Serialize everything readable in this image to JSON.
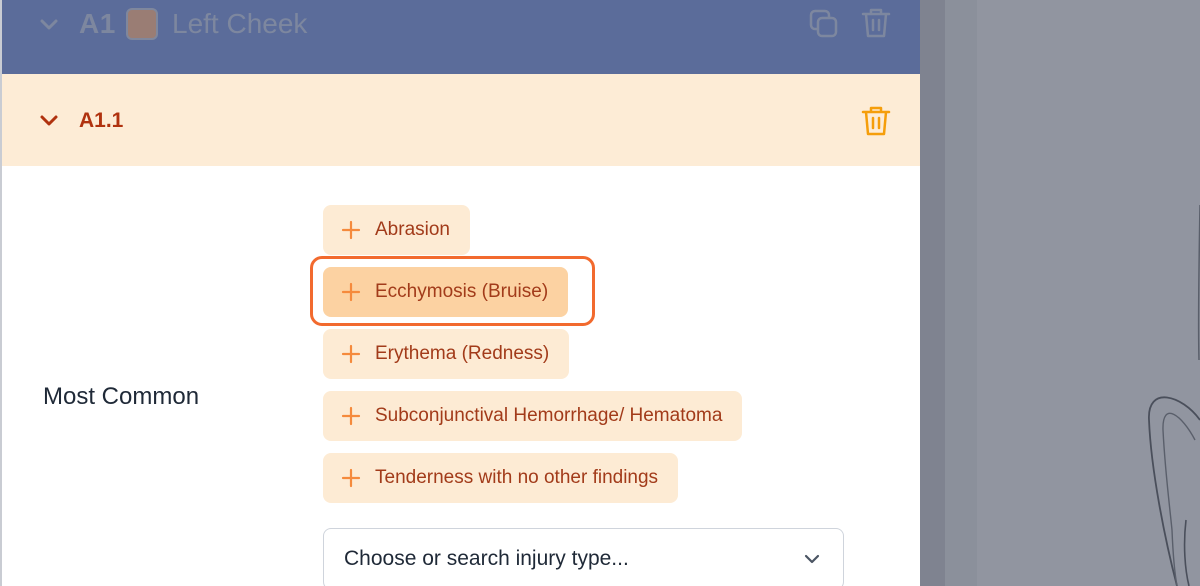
{
  "region": {
    "code": "A1",
    "name": "Left Cheek",
    "swatch_color": "#9a7d74",
    "header_color": "#5b6c9a"
  },
  "subregion": {
    "code": "A1.1",
    "header_color": "#fdecd6",
    "accent_color": "#b0320f",
    "trash_color": "#f59e0b"
  },
  "injuries": {
    "section_label": "Most Common",
    "chips": [
      {
        "label": "Abrasion",
        "selected": false
      },
      {
        "label": "Ecchymosis (Bruise)",
        "selected": true
      },
      {
        "label": "Erythema (Redness)",
        "selected": false
      },
      {
        "label": "Subconjunctival Hemorrhage/ Hematoma",
        "selected": false
      },
      {
        "label": "Tenderness with no other findings",
        "selected": false
      }
    ],
    "chip_color": "#fdebd4",
    "chip_text_color": "#a23b1a",
    "focus_color": "#f26a2e",
    "select_placeholder": "Choose or search injury type..."
  },
  "icons": {
    "region_toggle": "chevron-down-icon",
    "region_copy": "copy-icon",
    "region_delete": "trash-icon",
    "subregion_toggle": "chevron-down-icon",
    "subregion_delete": "trash-icon",
    "chip_add": "plus-icon",
    "select_toggle": "chevron-down-icon"
  }
}
